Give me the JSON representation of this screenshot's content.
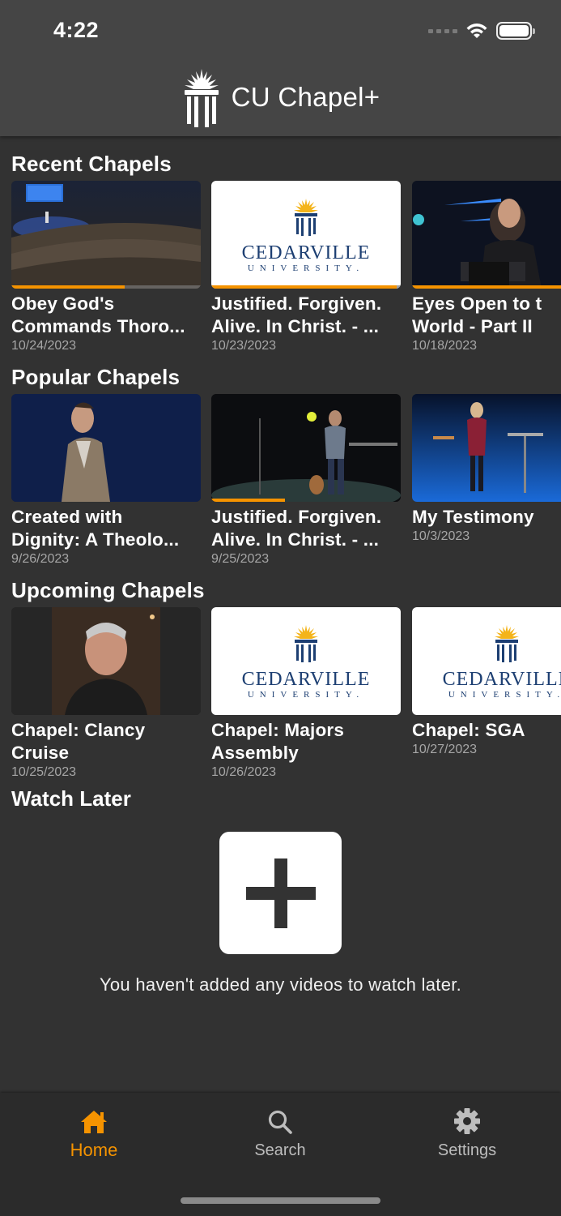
{
  "status_bar": {
    "time": "4:22"
  },
  "header": {
    "title": "CU Chapel+"
  },
  "sections": {
    "recent": {
      "title": "Recent Chapels",
      "items": [
        {
          "title": "Obey God's\nCommands Thoro...",
          "date": "10/24/2023",
          "progress": 0.6
        },
        {
          "title": "Justified. Forgiven.\nAlive. In Christ. - ...",
          "date": "10/23/2023",
          "progress": 0.98
        },
        {
          "title": "Eyes Open to t\nWorld - Part II",
          "date": "10/18/2023",
          "progress": 1.0
        }
      ]
    },
    "popular": {
      "title": "Popular Chapels",
      "items": [
        {
          "title": "Created with\nDignity:  A Theolo...",
          "date": "9/26/2023"
        },
        {
          "title": "Justified. Forgiven.\nAlive. In Christ. - ...",
          "date": "9/25/2023",
          "progress": 0.39
        },
        {
          "title": "My Testimony",
          "date": "10/3/2023"
        }
      ]
    },
    "upcoming": {
      "title": "Upcoming Chapels",
      "items": [
        {
          "title": "Chapel:  Clancy\nCruise",
          "date": "10/25/2023"
        },
        {
          "title": "Chapel:  Majors\nAssembly",
          "date": "10/26/2023"
        },
        {
          "title": "Chapel:  SGA",
          "date": "10/27/2023"
        }
      ]
    }
  },
  "cedarville_logo": {
    "word": "CEDARVILLE",
    "sub": "UNIVERSITY."
  },
  "watch_later": {
    "title": "Watch Later",
    "empty_message": "You haven't added any videos to watch later."
  },
  "tabbar": {
    "home": "Home",
    "search": "Search",
    "settings": "Settings"
  },
  "colors": {
    "accent": "#f59300",
    "background": "#323232",
    "header": "#454545",
    "brand_navy": "#1d3f72"
  },
  "icons": [
    "signal-icon",
    "wifi-icon",
    "battery-icon",
    "chapel-logo-icon",
    "plus-icon",
    "home-icon",
    "search-icon",
    "gear-icon"
  ]
}
